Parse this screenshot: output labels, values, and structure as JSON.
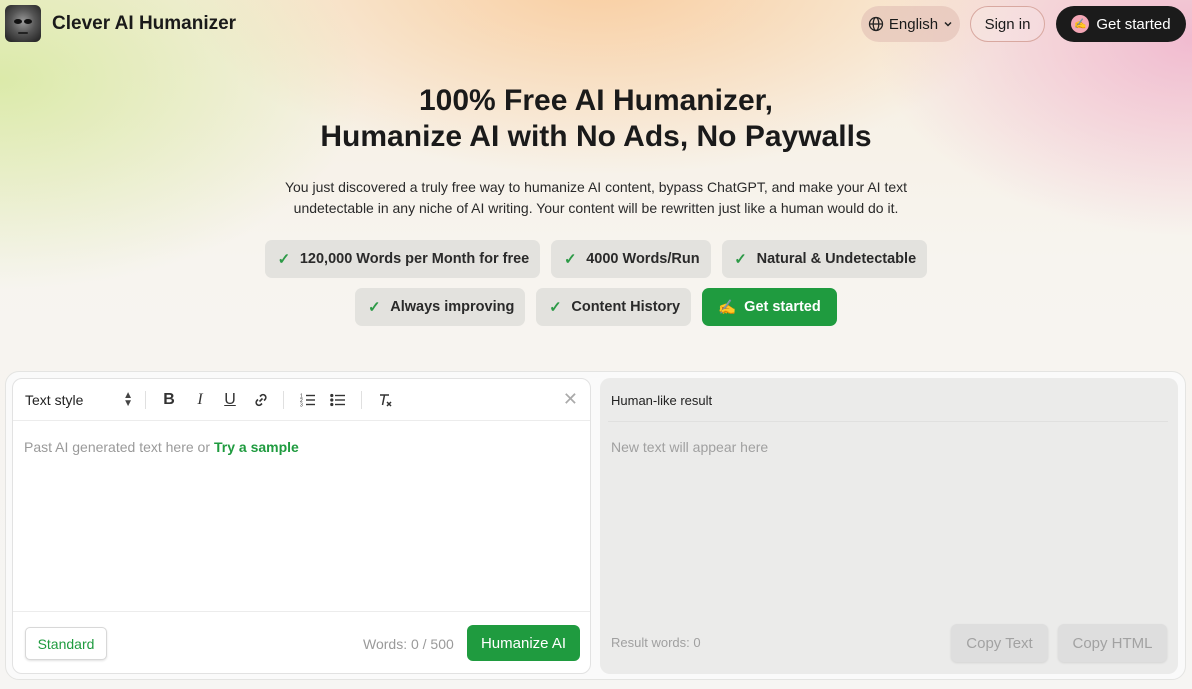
{
  "header": {
    "brand": "Clever AI Humanizer",
    "language": "English",
    "signin": "Sign in",
    "get_started": "Get started"
  },
  "hero": {
    "title_line1": "100% Free AI Humanizer,",
    "title_line2": "Humanize AI with No Ads, No Paywalls",
    "subtitle_line1": "You just discovered a truly free way to humanize AI content, bypass ChatGPT, and make your AI text",
    "subtitle_line2": "undetectable in any niche of AI writing. Your content will be rewritten just like a human would do it."
  },
  "features": {
    "row1": [
      "120,000 Words per Month for free",
      "4000 Words/Run",
      "Natural & Undetectable"
    ],
    "row2": [
      "Always improving",
      "Content History"
    ],
    "cta": "Get started",
    "cta_emoji": "✍️"
  },
  "editor": {
    "text_style": "Text style",
    "placeholder": "Past AI generated text here or",
    "sample_link": "Try a sample",
    "mode": "Standard",
    "word_count": "Words: 0 / 500",
    "humanize": "Humanize AI"
  },
  "result": {
    "title": "Human-like result",
    "placeholder": "New text will appear here",
    "result_words": "Result words: 0",
    "copy_text": "Copy Text",
    "copy_html": "Copy HTML"
  },
  "colors": {
    "accent_green": "#1f9b3f",
    "dark_button": "#1b1b1b"
  },
  "icons": [
    "globe-icon",
    "chevron-down-icon",
    "bold-icon",
    "italic-icon",
    "underline-icon",
    "link-icon",
    "ordered-list-icon",
    "bullet-list-icon",
    "clear-format-icon",
    "close-icon",
    "check-icon"
  ]
}
